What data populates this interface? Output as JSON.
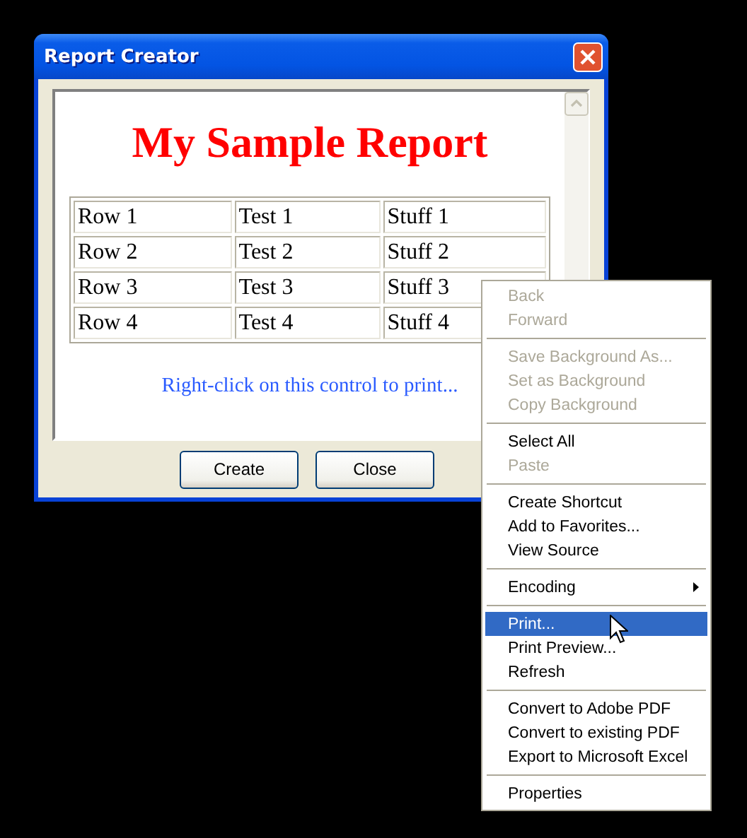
{
  "window": {
    "title": "Report Creator"
  },
  "report": {
    "heading": "My Sample Report",
    "rows": [
      [
        "Row 1",
        "Test 1",
        "Stuff 1"
      ],
      [
        "Row 2",
        "Test 2",
        "Stuff 2"
      ],
      [
        "Row 3",
        "Test 3",
        "Stuff 3"
      ],
      [
        "Row 4",
        "Test 4",
        "Stuff 4"
      ]
    ],
    "note": "Right-click on this control to print..."
  },
  "buttons": [
    "Create",
    "Close"
  ],
  "context_menu": {
    "groups": [
      {
        "items": [
          {
            "label": "Back",
            "kind": "command",
            "disabled": true,
            "selected": false
          },
          {
            "label": "Forward",
            "kind": "command",
            "disabled": true,
            "selected": false
          }
        ]
      },
      {
        "items": [
          {
            "label": "Save Background As...",
            "kind": "command",
            "disabled": true,
            "selected": false
          },
          {
            "label": "Set as Background",
            "kind": "command",
            "disabled": true,
            "selected": false
          },
          {
            "label": "Copy Background",
            "kind": "command",
            "disabled": true,
            "selected": false
          }
        ]
      },
      {
        "items": [
          {
            "label": "Select All",
            "kind": "command",
            "disabled": false,
            "selected": false
          },
          {
            "label": "Paste",
            "kind": "command",
            "disabled": true,
            "selected": false
          }
        ]
      },
      {
        "items": [
          {
            "label": "Create Shortcut",
            "kind": "command",
            "disabled": false,
            "selected": false
          },
          {
            "label": "Add to Favorites...",
            "kind": "command",
            "disabled": false,
            "selected": false
          },
          {
            "label": "View Source",
            "kind": "command",
            "disabled": false,
            "selected": false
          }
        ]
      },
      {
        "items": [
          {
            "label": "Encoding",
            "kind": "submenu",
            "disabled": false,
            "selected": false
          }
        ]
      },
      {
        "items": [
          {
            "label": "Print...",
            "kind": "command",
            "disabled": false,
            "selected": true
          },
          {
            "label": "Print Preview...",
            "kind": "command",
            "disabled": false,
            "selected": false
          },
          {
            "label": "Refresh",
            "kind": "command",
            "disabled": false,
            "selected": false
          }
        ]
      },
      {
        "items": [
          {
            "label": "Convert to Adobe PDF",
            "kind": "command",
            "disabled": false,
            "selected": false
          },
          {
            "label": "Convert to existing PDF",
            "kind": "command",
            "disabled": false,
            "selected": false
          },
          {
            "label": "Export to Microsoft Excel",
            "kind": "command",
            "disabled": false,
            "selected": false
          }
        ]
      },
      {
        "items": [
          {
            "label": "Properties",
            "kind": "command",
            "disabled": false,
            "selected": false
          }
        ]
      }
    ]
  }
}
